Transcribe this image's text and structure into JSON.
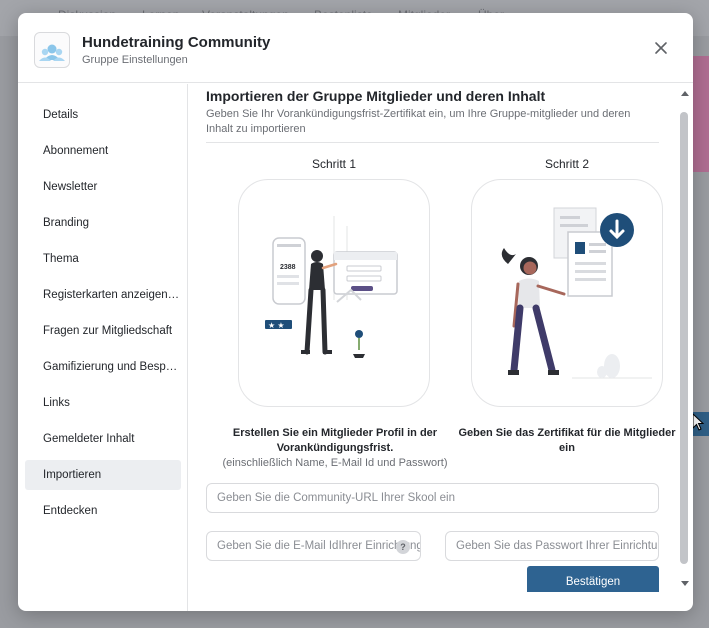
{
  "background": {
    "tabs": [
      "Diskussion",
      "Lernen",
      "Veranstaltungen",
      "Bestenliste",
      "Mitglieder",
      "Über"
    ]
  },
  "header": {
    "title": "Hundetraining Community",
    "subtitle": "Gruppe Einstellungen"
  },
  "sidebar": {
    "items": [
      {
        "label": "Details"
      },
      {
        "label": "Abonnement"
      },
      {
        "label": "Newsletter"
      },
      {
        "label": "Branding"
      },
      {
        "label": "Thema"
      },
      {
        "label": "Registerkarten anzeigen/ausblenden"
      },
      {
        "label": "Fragen zur Mitgliedschaft"
      },
      {
        "label": "Gamifizierung und Besprechungen"
      },
      {
        "label": "Links"
      },
      {
        "label": "Gemeldeter Inhalt"
      },
      {
        "label": "Importieren",
        "active": true
      },
      {
        "label": "Entdecken"
      }
    ]
  },
  "content": {
    "title": "Importieren der Gruppe Mitglieder und deren Inhalt",
    "description": "Geben Sie Ihr Vorankündigungsfrist-Zertifikat ein, um Ihre Gruppe-mitglieder und deren Inhalt zu importieren",
    "steps": [
      {
        "label": "Schritt 1",
        "caption": "Erstellen Sie ein Mitglieder Profil in der Vorankündigungsfrist.",
        "subcaption": "(einschließlich Name, E-Mail Id und Passwort)",
        "illustration_text": "2388"
      },
      {
        "label": "Schritt 2",
        "caption": "Geben Sie das Zertifikat für die Mitglieder ein"
      }
    ],
    "inputs": {
      "url_placeholder": "Geben Sie die Community-URL Ihrer Skool ein",
      "email_placeholder": "Geben Sie die E-Mail IdIhrer Einrichtung ein",
      "password_placeholder": "Geben Sie das Passwort Ihrer Einrichtung ein",
      "help_glyph": "?"
    },
    "confirm_label": "Bestätigen"
  },
  "colors": {
    "accent": "#2e6391",
    "active_item_bg": "#eceef1",
    "illustration_purple": "#5b4f86",
    "illustration_blue": "#1f4e79"
  },
  "icons": {
    "logo": "group-avatars-icon",
    "close": "close-icon",
    "help": "question-icon",
    "download": "download-arrow-icon"
  }
}
